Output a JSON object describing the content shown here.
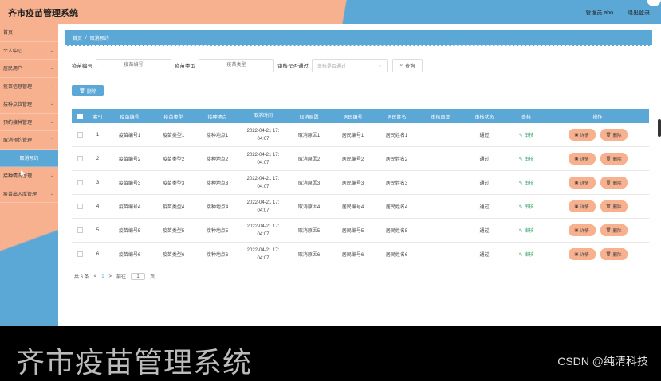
{
  "header": {
    "title": "齐市疫苗管理系统",
    "user": "管理员 abo",
    "logout": "退出登录"
  },
  "sidebar": {
    "items": [
      {
        "label": "首页",
        "chevron": false
      },
      {
        "label": "个人中心",
        "chevron": true
      },
      {
        "label": "居民用户",
        "chevron": true
      },
      {
        "label": "疫苗信息管理",
        "chevron": true
      },
      {
        "label": "接种点位管理",
        "chevron": true
      },
      {
        "label": "预约接种管理",
        "chevron": true
      },
      {
        "label": "取消预约管理",
        "chevron": true
      },
      {
        "label": "取消预约",
        "sub": true
      },
      {
        "label": "接种情况管理",
        "chevron": true
      },
      {
        "label": "疫苗出入库管理",
        "chevron": true
      }
    ]
  },
  "breadcrumb": {
    "home": "首页",
    "current": "取消预约"
  },
  "search": {
    "label_code": "疫苗编号",
    "placeholder_code": "疫苗编号",
    "label_type": "疫苗类型",
    "placeholder_type": "疫苗类型",
    "label_audit": "审核是否通过",
    "placeholder_audit": "审核是否通过",
    "button": "查询"
  },
  "toolbar": {
    "delete": "删除"
  },
  "table": {
    "headers": [
      "索引",
      "疫苗编号",
      "疫苗类型",
      "接种地点",
      "取消时间",
      "取消原因",
      "居民编号",
      "居民姓名",
      "审核回复",
      "审核状态",
      "审核",
      "操作"
    ],
    "rows": [
      {
        "idx": "1",
        "code": "疫苗编号1",
        "type": "疫苗类型1",
        "site": "接种地点1",
        "date": "2022-04-21 17:",
        "clock": "04:07",
        "reason": "取消原因1",
        "rid": "居民编号1",
        "rname": "居民姓名1",
        "reply": "",
        "status": "通过"
      },
      {
        "idx": "2",
        "code": "疫苗编号2",
        "type": "疫苗类型2",
        "site": "接种地点2",
        "date": "2022-04-21 17:",
        "clock": "04:07",
        "reason": "取消原因2",
        "rid": "居民编号2",
        "rname": "居民姓名2",
        "reply": "",
        "status": "通过"
      },
      {
        "idx": "3",
        "code": "疫苗编号3",
        "type": "疫苗类型3",
        "site": "接种地点3",
        "date": "2022-04-21 17:",
        "clock": "04:07",
        "reason": "取消原因3",
        "rid": "居民编号3",
        "rname": "居民姓名3",
        "reply": "",
        "status": "通过"
      },
      {
        "idx": "4",
        "code": "疫苗编号4",
        "type": "疫苗类型4",
        "site": "接种地点4",
        "date": "2022-04-21 17:",
        "clock": "04:07",
        "reason": "取消原因4",
        "rid": "居民编号4",
        "rname": "居民姓名4",
        "reply": "",
        "status": "通过"
      },
      {
        "idx": "5",
        "code": "疫苗编号5",
        "type": "疫苗类型5",
        "site": "接种地点5",
        "date": "2022-04-21 17:",
        "clock": "04:07",
        "reason": "取消原因5",
        "rid": "居民编号5",
        "rname": "居民姓名5",
        "reply": "",
        "status": "通过"
      },
      {
        "idx": "6",
        "code": "疫苗编号6",
        "type": "疫苗类型6",
        "site": "接种地点6",
        "date": "2022-04-21 17:",
        "clock": "04:07",
        "reason": "取消原因6",
        "rid": "居民编号6",
        "rname": "居民姓名6",
        "reply": "",
        "status": "通过"
      }
    ],
    "audit_label": "审核",
    "detail_label": "详情",
    "delete_label": "删除"
  },
  "pager": {
    "total": "共 6 条",
    "prev": "<",
    "page": "1",
    "next": ">",
    "goto": "前往",
    "goto_value": "1",
    "unit": "页"
  },
  "caption": "齐市疫苗管理系统",
  "watermark": "CSDN @纯清科技",
  "colors": {
    "accent_blue": "#5ba7d6",
    "accent_peach": "#f7b18f",
    "audit_green": "#3aa36b"
  }
}
